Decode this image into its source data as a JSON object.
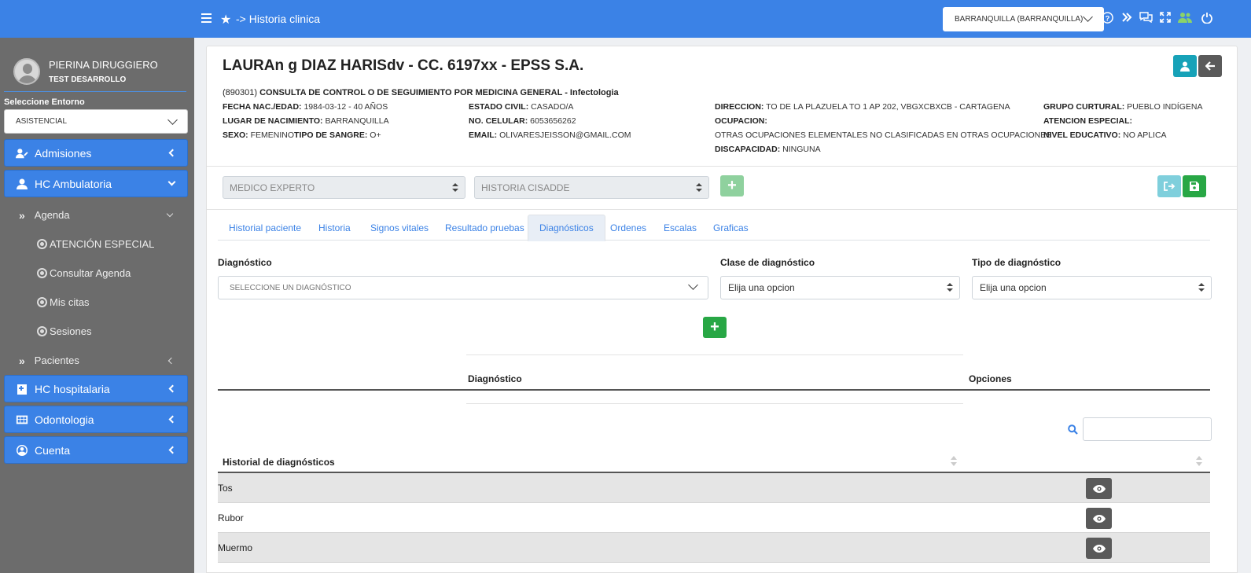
{
  "sidebar": {
    "user": {
      "name": "PIERINA DIRUGGIERO",
      "role": "TEST DESARROLLO"
    },
    "env_label": "Seleccione Entorno",
    "env_value": "ASISTENCIAL",
    "nav": {
      "admisiones": "Admisiones",
      "hc_ambulatoria": "HC Ambulatoria",
      "agenda": "Agenda",
      "atencion_especial": "ATENCIÓN ESPECIAL",
      "consultar_agenda": "Consultar Agenda",
      "mis_citas": "Mis citas",
      "sesiones": "Sesiones",
      "pacientes": "Pacientes",
      "hc_hospitalaria": "HC hospitalaria",
      "odontologia": "Odontologia",
      "cuenta": "Cuenta"
    }
  },
  "topbar": {
    "breadcrumb": "-> Historia clinica",
    "city": "BARRANQUILLA (BARRANQUILLA)",
    "icons": [
      "question-icon",
      "double-chevron-icon",
      "chat-icon",
      "expand-icon",
      "users-icon",
      "power-icon"
    ]
  },
  "patient": {
    "title": "LAURAn g DIAZ HARISdv - CC. 6197xx - EPSS S.A.",
    "consult_code": "(890301)",
    "consult_name": "CONSULTA DE CONTROL O DE SEGUIMIENTO POR MEDICINA GENERAL",
    "consult_specialty": " - Infectologia",
    "fecha_label": "FECHA NAC./EDAD:",
    "fecha_value": "1984-03-12 - 40 AÑOS",
    "lugar_label": "LUGAR DE NACIMIENTO:",
    "lugar_value": "BARRANQUILLA",
    "sexo_label": "SEXO:",
    "sexo_value": "FEMENINO",
    "sangre_label": "TIPO DE SANGRE:",
    "sangre_value": "O+",
    "civil_label": "ESTADO CIVIL:",
    "civil_value": "CASADO/A",
    "celular_label": "NO. CELULAR:",
    "celular_value": "6053656262",
    "email_label": "EMAIL:",
    "email_value": "OLIVARESJEISSON@GMAIL.COM",
    "direccion_label": "DIRECCION:",
    "direccion_value": "TO DE LA PLAZUELA TO 1 AP 202, VBGXCBXCB - CARTAGENA",
    "ocupacion_label": "OCUPACION:",
    "ocupacion_value": "OTRAS OCUPACIONES ELEMENTALES NO CLASIFICADAS EN OTRAS OCUPACIONES",
    "discapacidad_label": "DISCAPACIDAD:",
    "discapacidad_value": "NINGUNA",
    "grupo_label": "GRUPO CURTURAL:",
    "grupo_value": "PUEBLO INDÍGENA",
    "atencion_label": "ATENCION ESPECIAL:",
    "nivel_label": "NIVEL EDUCATIVO:",
    "nivel_value": "NO APLICA"
  },
  "toolbar": {
    "medico": "MEDICO EXPERTO",
    "historia": "HISTORIA CISADDE"
  },
  "tabs": [
    "Historial paciente",
    "Historia",
    "Signos vitales",
    "Resultado pruebas",
    "Diagnósticos",
    "Ordenes",
    "Escalas",
    "Graficas"
  ],
  "form": {
    "diag_label": "Diagnóstico",
    "diag_placeholder": "SELECCIONE UN DIAGNÓSTICO",
    "clase_label": "Clase de diagnóstico",
    "clase_value": "Elija una opcion",
    "tipo_label": "Tipo de diagnóstico",
    "tipo_value": "Elija una opcion"
  },
  "diag_table": {
    "col1": "Diagnóstico",
    "col2": "Opciones"
  },
  "history": {
    "header": "Historial de diagnósticos",
    "rows": [
      "Tos",
      "Rubor",
      "Muermo"
    ]
  },
  "colors": {
    "primary": "#3b82e6",
    "sidebar": "#6c6c6c",
    "teal": "#17a2b8",
    "green": "#28a745",
    "dark": "#5a5a5a"
  }
}
